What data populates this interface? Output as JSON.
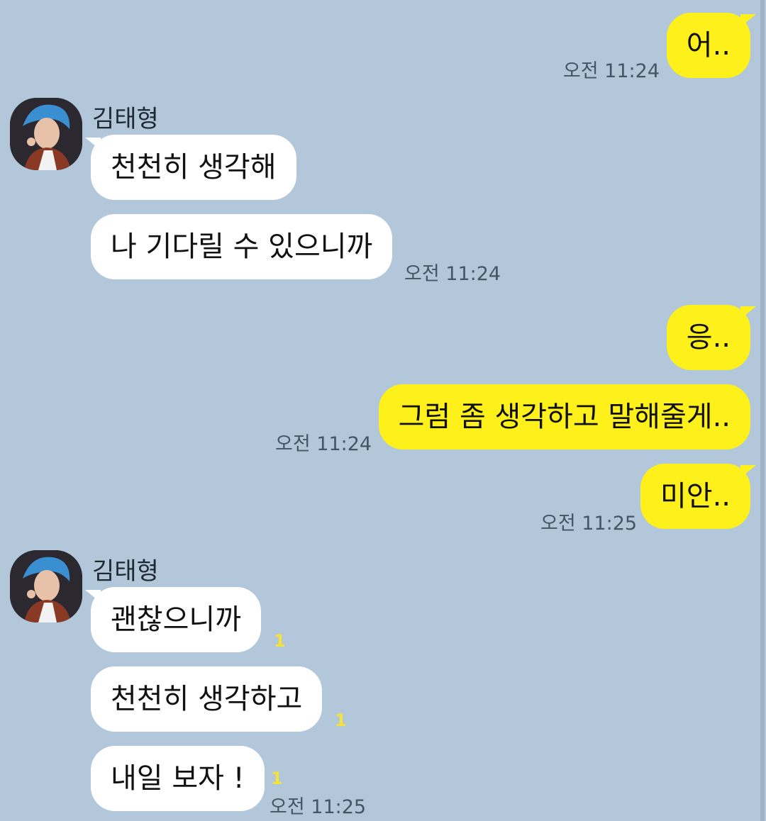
{
  "messages": {
    "m1": {
      "text": "어..",
      "time": "오전 11:24"
    },
    "sender1": "김태형",
    "m2": {
      "text": "천천히 생각해"
    },
    "m3": {
      "text": "나 기다릴 수 있으니까",
      "time": "오전 11:24"
    },
    "m4": {
      "text": "응.."
    },
    "m5": {
      "text": "그럼 좀 생각하고 말해줄게..",
      "time": "오전 11:24"
    },
    "m6": {
      "text": "미안..",
      "time": "오전 11:25"
    },
    "sender2": "김태형",
    "m7": {
      "text": "괜찮으니까",
      "unread": "1"
    },
    "m8": {
      "text": "천천히 생각하고",
      "unread": "1"
    },
    "m9": {
      "text": "내일 보자 !",
      "unread": "1",
      "time": "오전 11:25"
    }
  },
  "colors": {
    "background": "#b2c7da",
    "my_bubble": "#fef01b",
    "their_bubble": "#ffffff",
    "unread": "#f5e23a"
  }
}
